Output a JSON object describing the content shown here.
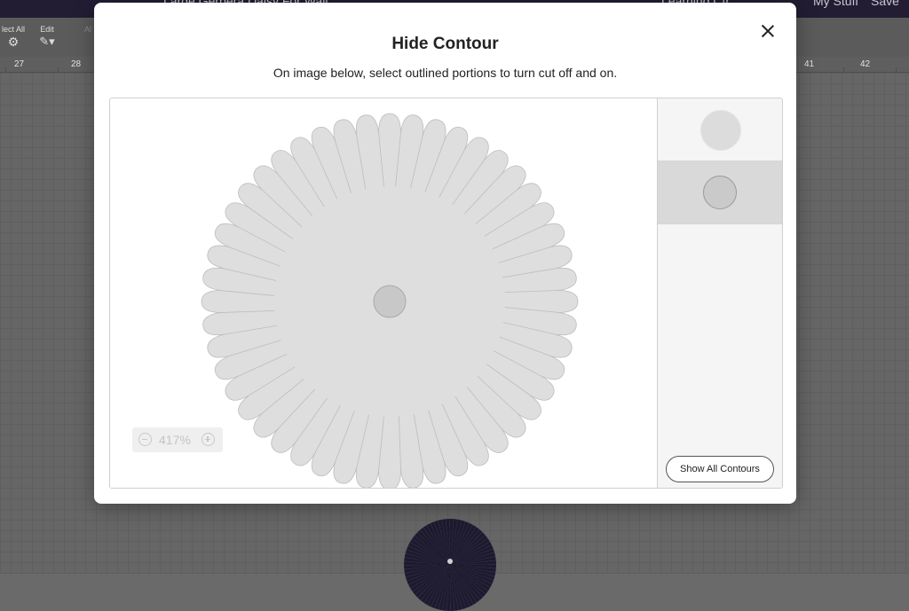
{
  "app": {
    "project_title": "Large Gerbera Daisy For Wall",
    "top_links": [
      "Learning Ctr",
      "My Stuff",
      "Save"
    ],
    "toolbar": {
      "select_all": "lect All",
      "edit": "Edit",
      "align": "Al"
    },
    "ruler_ticks": [
      "27",
      "28",
      "41",
      "42"
    ]
  },
  "modal": {
    "title": "Hide Contour",
    "subtitle": "On image below, select outlined portions to turn cut off and on.",
    "zoom_level": "417%",
    "show_all_label": "Show All Contours",
    "thumbnails": [
      "outer-petals-layer",
      "center-circle-layer"
    ],
    "selected_thumbnail": 1
  },
  "colors": {
    "petal_fill": "#dedede",
    "petal_stroke": "#bdbdbd",
    "center_fill": "#c8c8c8",
    "selected_row": "#d9d9d9",
    "app_bar": "#221d33"
  }
}
